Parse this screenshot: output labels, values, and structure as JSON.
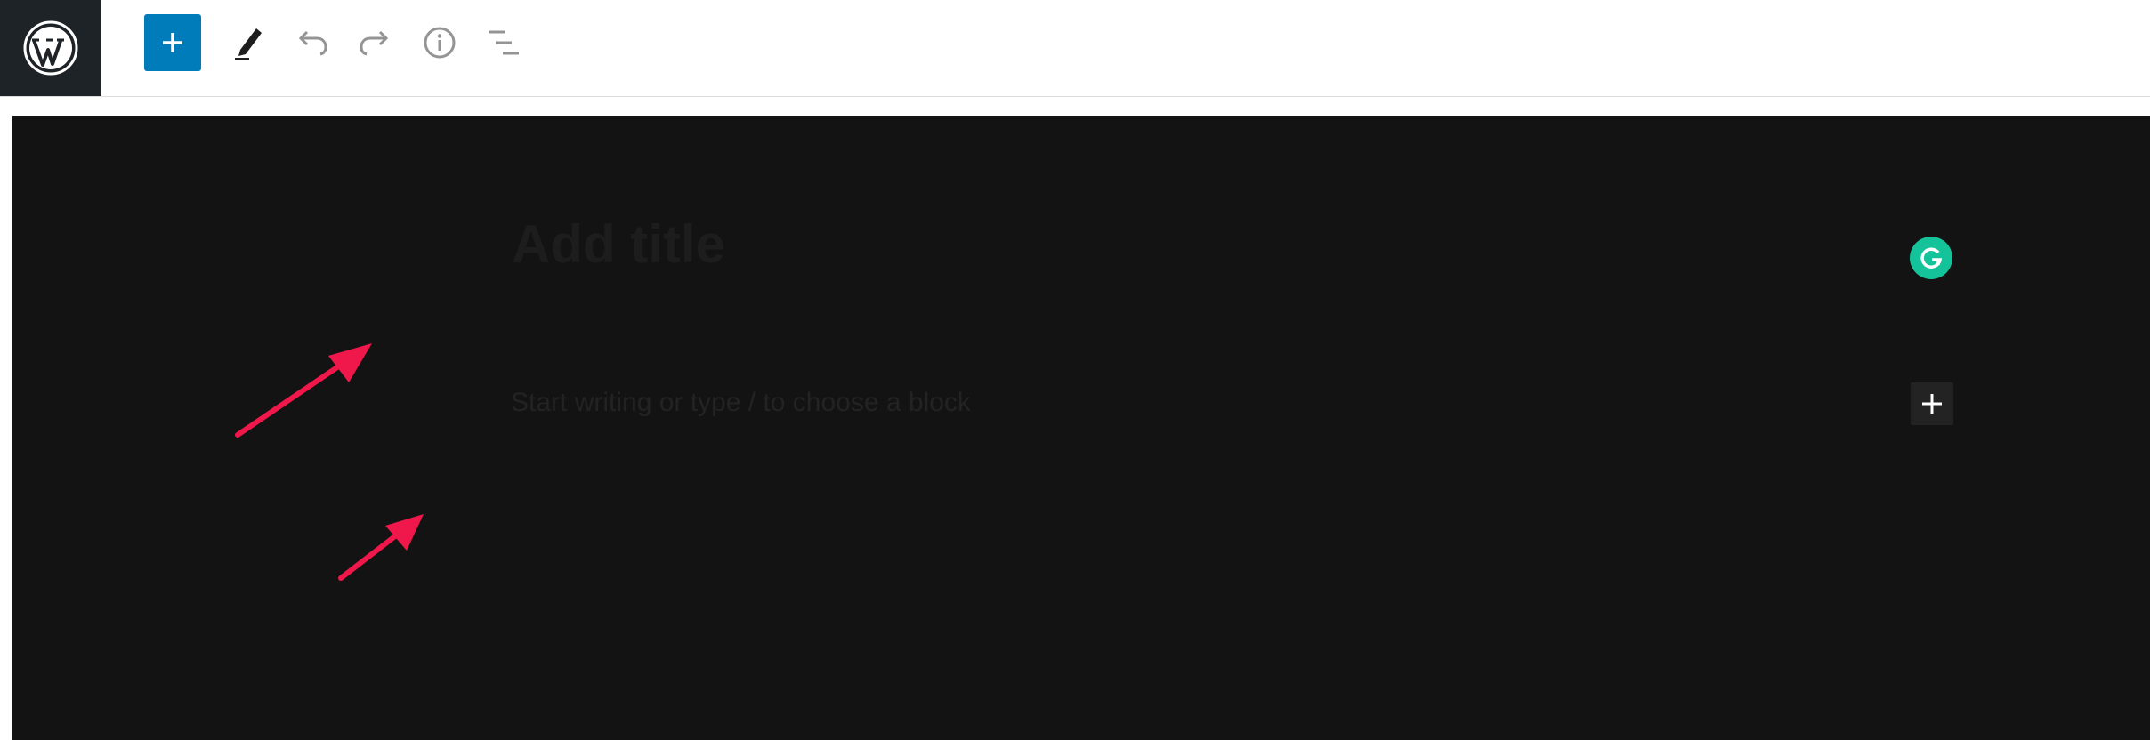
{
  "toolbar": {
    "items": [
      {
        "name": "wordpress-logo-icon"
      },
      {
        "name": "plus-icon",
        "role": "toggle block inserter"
      },
      {
        "name": "pencil-icon",
        "role": "tools"
      },
      {
        "name": "undo-icon"
      },
      {
        "name": "redo-icon"
      },
      {
        "name": "info-icon",
        "role": "details"
      },
      {
        "name": "list-view-icon",
        "role": "outline"
      }
    ]
  },
  "editor": {
    "title_placeholder": "Add title",
    "body_placeholder": "Start writing or type / to choose a block"
  },
  "colors": {
    "accent": "#007cba",
    "logo_bg": "#1e2327",
    "canvas_bg": "#131313",
    "grammarly": "#15c39a",
    "annotation_arrow": "#f0174a"
  },
  "annotations": [
    {
      "type": "arrow",
      "points_to": "title-placeholder"
    },
    {
      "type": "arrow",
      "points_to": "body-placeholder"
    }
  ]
}
